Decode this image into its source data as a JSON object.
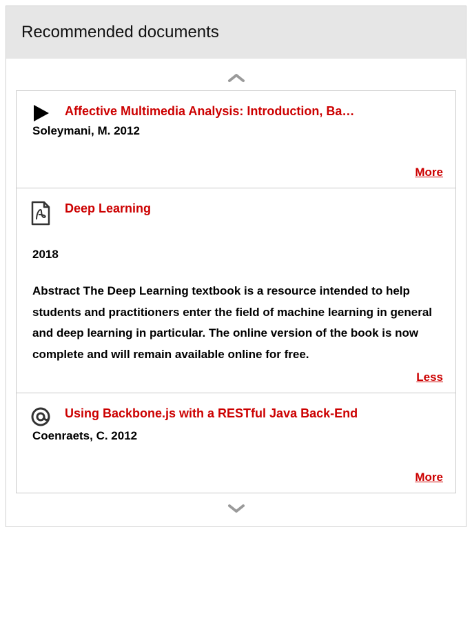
{
  "panel_title": "Recommended documents",
  "toggle_more": "More",
  "toggle_less": "Less",
  "documents": [
    {
      "title": "Affective Multimedia Analysis: Introduction, Ba…",
      "author": "Soleymani, M. 2012",
      "expanded": false
    },
    {
      "title": "Deep Learning",
      "year": "2018",
      "abstract": "Abstract The Deep Learning textbook is a resource intended to help students and practitioners enter the field of machine learning in general and deep learning in particular. The online version of the book is now complete and will remain available online for free.",
      "expanded": true
    },
    {
      "title": "Using Backbone.js with a RESTful Java Back-End",
      "author": "Coenraets, C. 2012",
      "expanded": false
    }
  ]
}
